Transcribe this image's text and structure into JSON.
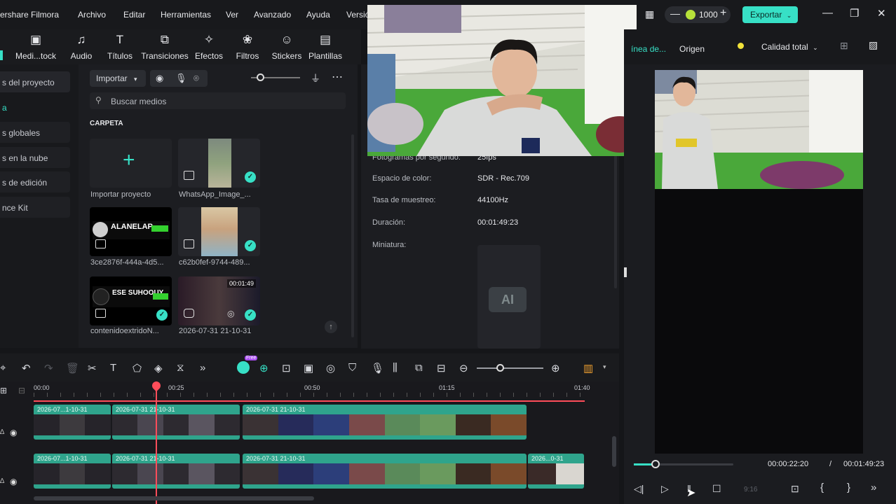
{
  "titlebar": {
    "brand": "ershare Filmora",
    "menus": [
      "Archivo",
      "Editar",
      "Herramientas",
      "Ver",
      "Avanzado",
      "Ayuda",
      "Versió"
    ],
    "credits": "1000",
    "export_label": "Exportar"
  },
  "toolbar": {
    "tools": [
      {
        "label": "Medi...tock",
        "icon": "media-stock-icon"
      },
      {
        "label": "Audio",
        "icon": "music-note-icon"
      },
      {
        "label": "Títulos",
        "icon": "text-icon"
      },
      {
        "label": "Transiciones",
        "icon": "transition-icon"
      },
      {
        "label": "Efectos",
        "icon": "effects-icon"
      },
      {
        "label": "Filtros",
        "icon": "filter-icon"
      },
      {
        "label": "Stickers",
        "icon": "sticker-icon"
      },
      {
        "label": "Plantillas",
        "icon": "template-icon"
      }
    ]
  },
  "sidebar": {
    "items": [
      "s del proyecto",
      "a",
      "s globales",
      "s en la nube",
      "s de edición",
      "nce Kit"
    ]
  },
  "media": {
    "import_label": "Importar",
    "search_placeholder": "Buscar medios",
    "folder_title": "CARPETA",
    "items": [
      {
        "label": "Importar proyecto"
      },
      {
        "label": "WhatsApp_Image_..."
      },
      {
        "label": "3ce2876f-444a-4d5..."
      },
      {
        "label": "c62b0fef-9744-489..."
      },
      {
        "label": "contenidoextridoN..."
      },
      {
        "label": "2026-07-31 21-10-31",
        "duration": "00:01:49"
      }
    ],
    "thumb_texts": {
      "alanelap": "ALANELAP",
      "ese": "ESE SUHOOUY"
    }
  },
  "properties": {
    "rows": [
      {
        "key": "Fotogramas por segundo:",
        "value": "25fps"
      },
      {
        "key": "Espacio de color:",
        "value": "SDR - Rec.709"
      },
      {
        "key": "Tasa de muestreo:",
        "value": "44100Hz"
      },
      {
        "key": "Duración:",
        "value": "00:01:49:23"
      },
      {
        "key": "Miniatura:",
        "value": ""
      }
    ]
  },
  "player": {
    "tab_timeline": "ínea de...",
    "tab_origin": "Origen",
    "quality": "Calidad total",
    "current_time": "00:00:22:20",
    "separator": "/",
    "total_time": "00:01:49:23",
    "ratio": "9:16",
    "progress": 0.22
  },
  "timeline": {
    "ruler": [
      "00:00",
      "00:25",
      "00:50",
      "01:15",
      "01:40"
    ],
    "new_badge": "Free",
    "track1_clips": [
      "2026-07...1-10-31",
      "2026-07-31 21-10-31",
      "2026-07-31 21-10-31"
    ],
    "track2_clips": [
      "2026-07...1-10-31",
      "2026-07-31 21-10-31",
      "2026-07-31 21-10-31",
      "2026...0-31"
    ]
  },
  "colors": {
    "accent": "#37e0c6",
    "playhead": "#ff4d5a",
    "clip": "#2fa48c"
  }
}
